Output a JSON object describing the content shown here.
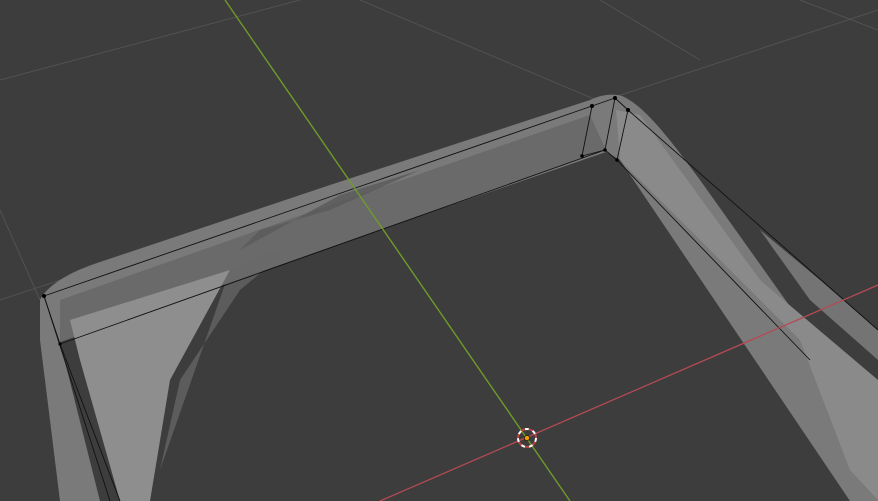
{
  "viewport": {
    "colors": {
      "background": "#3d3d3d",
      "grid": "#525252",
      "x_axis": "#b34a52",
      "y_axis": "#6f9a2a",
      "mesh_light": "#8a8a8a",
      "mesh_mid": "#6e6e6e",
      "mesh_dark": "#4c4c4c",
      "wire": "#111111",
      "vertex": "#000000",
      "cursor_ring_a": "#ffffff",
      "cursor_ring_b": "#c04040",
      "origin": "#f0a000"
    },
    "icons": {
      "cursor": "3d-cursor-icon",
      "origin": "object-origin-icon"
    }
  }
}
